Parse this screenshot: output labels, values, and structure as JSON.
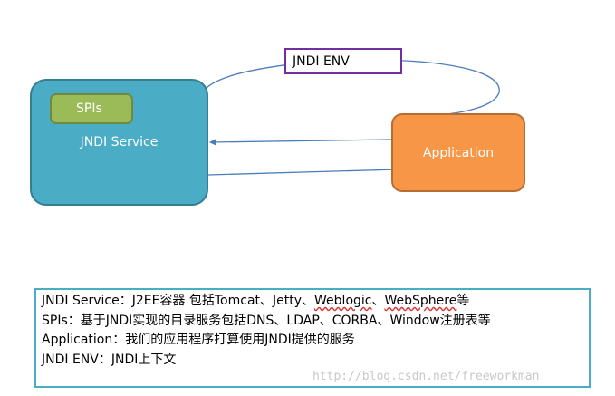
{
  "diagram": {
    "env_label": "JNDI ENV",
    "service_label": "JNDI Service",
    "spis_label": "SPIs",
    "application_label": "Application",
    "colors": {
      "service_fill": "#4bacc6",
      "spis_fill": "#9bbb59",
      "application_fill": "#f79646",
      "env_border": "#7030a0",
      "arrow": "#4a7ebb"
    }
  },
  "legend": {
    "line1": {
      "prefix": "JNDI Service：J2EE容器 包括Tomcat、Jetty、",
      "weblogic": "Weblogic",
      "sep": "、",
      "websphere": "WebSphere",
      "suffix": "等"
    },
    "line2": "SPIs：基于JNDI实现的目录服务包括DNS、LDAP、CORBA、Window注册表等",
    "line3": "Application：我们的应用程序打算使用JNDI提供的服务",
    "line4": "JNDI ENV：JNDI上下文"
  },
  "watermark": "http://blog.csdn.net/freeworkman"
}
